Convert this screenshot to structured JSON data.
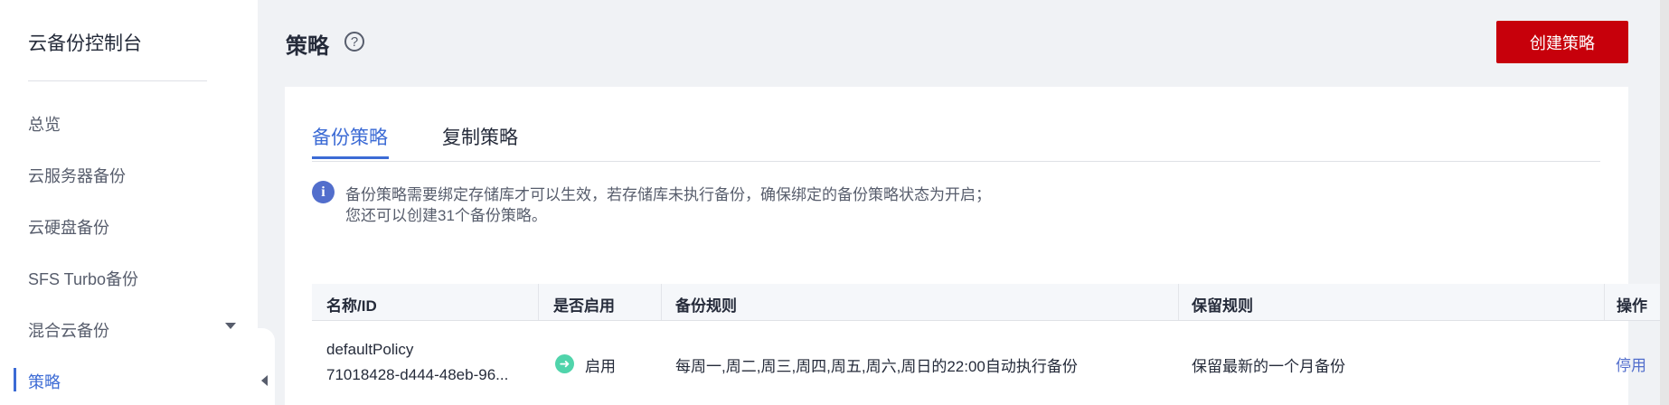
{
  "sidebar": {
    "title": "云备份控制台",
    "items": [
      {
        "label": "总览"
      },
      {
        "label": "云服务器备份"
      },
      {
        "label": "云硬盘备份"
      },
      {
        "label": "SFS Turbo备份"
      },
      {
        "label": "混合云备份"
      },
      {
        "label": "策略"
      }
    ]
  },
  "header": {
    "title": "策略",
    "help_icon": "?",
    "create_button": "创建策略"
  },
  "tabs": [
    {
      "label": "备份策略"
    },
    {
      "label": "复制策略"
    }
  ],
  "info": {
    "icon": "i",
    "line1": "备份策略需要绑定存储库才可以生效，若存储库未执行备份，确保绑定的备份策略状态为开启；",
    "line2": "您还可以创建31个备份策略。"
  },
  "table": {
    "columns": [
      "名称/ID",
      "是否启用",
      "备份规则",
      "保留规则",
      "操作"
    ],
    "rows": [
      {
        "name": "defaultPolicy",
        "id": "71018428-d444-48eb-96...",
        "status_icon": "➜",
        "status": "启用",
        "backup_rule": "每周一,周二,周三,周四,周五,周六,周日的22:00自动执行备份",
        "retention_rule": "保留最新的一个月备份",
        "action": "停用"
      }
    ]
  },
  "colors": {
    "primary": "#c7000b",
    "active_blue": "#3c6bd5",
    "status_green": "#50d4ab"
  }
}
